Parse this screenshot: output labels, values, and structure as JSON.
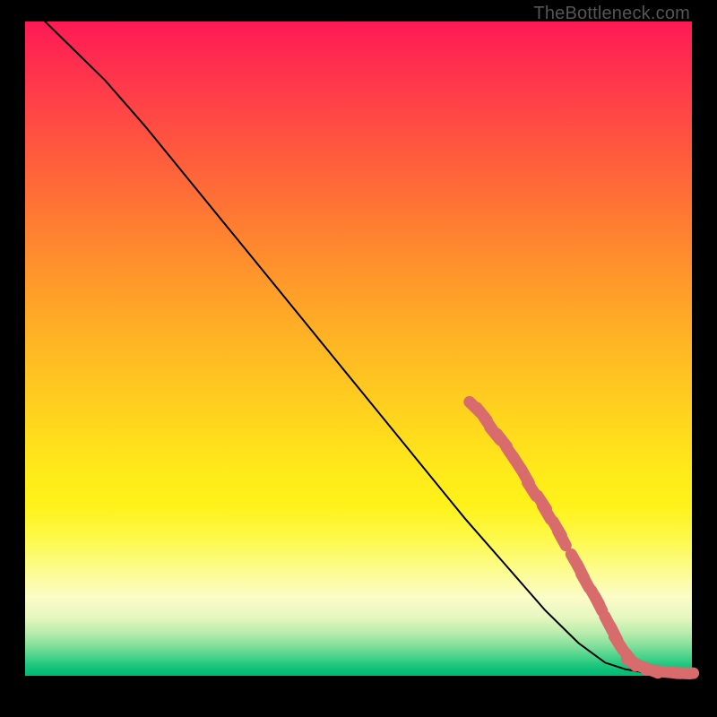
{
  "attribution": "TheBottleneck.com",
  "colors": {
    "line": "#000000",
    "marker": "#d86b6b",
    "background": "#000000"
  },
  "chart_data": {
    "type": "line",
    "title": "",
    "xlabel": "",
    "ylabel": "",
    "xlim": [
      0,
      100
    ],
    "ylim": [
      0,
      100
    ],
    "grid": false,
    "legend": false,
    "line_points": [
      [
        3,
        100
      ],
      [
        6,
        97
      ],
      [
        12,
        91
      ],
      [
        18,
        84
      ],
      [
        26,
        74
      ],
      [
        34,
        64
      ],
      [
        42,
        54
      ],
      [
        50,
        44
      ],
      [
        58,
        34
      ],
      [
        66,
        24
      ],
      [
        72,
        17
      ],
      [
        78,
        10
      ],
      [
        83,
        5
      ],
      [
        87,
        2
      ],
      [
        90,
        1
      ],
      [
        93,
        0.5
      ],
      [
        96,
        0.3
      ],
      [
        99,
        0.25
      ]
    ],
    "marker_clusters": [
      [
        67.5,
        41
      ],
      [
        68.5,
        40
      ],
      [
        69.5,
        38.5
      ],
      [
        70.5,
        37
      ],
      [
        71.5,
        36
      ],
      [
        72.8,
        34
      ],
      [
        73.8,
        32.5
      ],
      [
        75,
        30.5
      ],
      [
        76,
        28.5
      ],
      [
        77.5,
        26.5
      ],
      [
        78.2,
        25
      ],
      [
        79.8,
        22.5
      ],
      [
        80.5,
        21
      ],
      [
        82.5,
        17.5
      ],
      [
        83.3,
        16
      ],
      [
        84,
        14.5
      ],
      [
        85.5,
        12
      ],
      [
        86,
        11
      ],
      [
        87.5,
        8
      ],
      [
        88.3,
        6.5
      ],
      [
        89,
        5
      ],
      [
        90.8,
        2.5
      ],
      [
        91.3,
        2
      ],
      [
        93.8,
        0.9
      ],
      [
        94.3,
        0.8
      ],
      [
        97,
        0.5
      ],
      [
        98.5,
        0.4
      ],
      [
        99,
        0.4
      ]
    ]
  }
}
